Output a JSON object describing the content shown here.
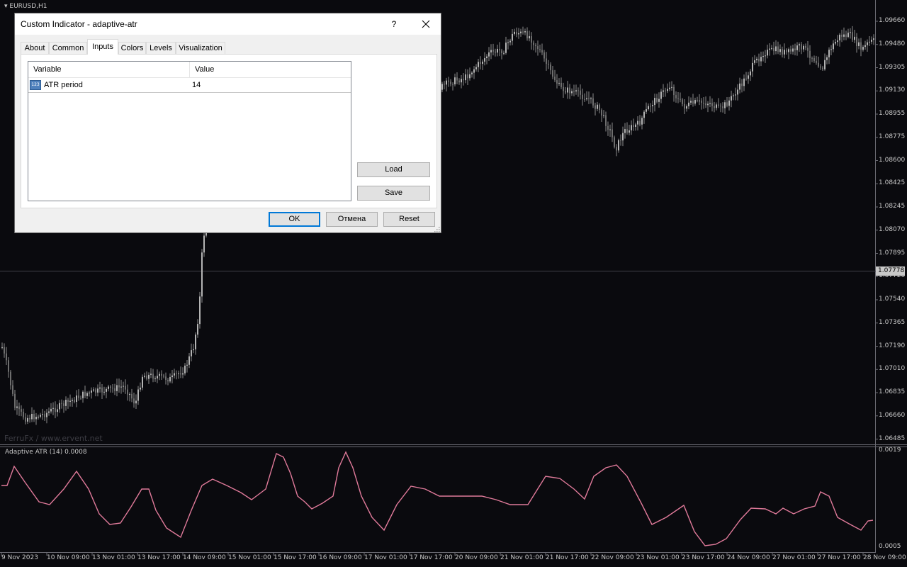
{
  "chart": {
    "symbol": "EURUSD,H1",
    "watermark": "FerruFx / www.ervent.net",
    "current_price": "1.07778",
    "price_axis": [
      "1.09660",
      "1.09480",
      "1.09305",
      "1.09130",
      "1.08955",
      "1.08775",
      "1.08600",
      "1.08425",
      "1.08245",
      "1.08070",
      "1.07895",
      "1.07720",
      "1.07540",
      "1.07365",
      "1.07190",
      "1.07010",
      "1.06835",
      "1.06660",
      "1.06485"
    ],
    "time_axis": [
      "9 Nov 2023",
      "10 Nov 09:00",
      "13 Nov 01:00",
      "13 Nov 17:00",
      "14 Nov 09:00",
      "15 Nov 01:00",
      "15 Nov 17:00",
      "16 Nov 09:00",
      "17 Nov 01:00",
      "17 Nov 17:00",
      "20 Nov 09:00",
      "21 Nov 01:00",
      "21 Nov 17:00",
      "22 Nov 09:00",
      "23 Nov 01:00",
      "23 Nov 17:00",
      "24 Nov 09:00",
      "27 Nov 01:00",
      "27 Nov 17:00",
      "28 Nov 09:00"
    ],
    "indicator_title": "Adaptive ATR (14) 0.0008",
    "indicator_axis": [
      "0.0019",
      "0.0005"
    ],
    "colors": {
      "background": "#0a0a0e",
      "candles": "#8c8c8c",
      "atr_line": "#e07a9a",
      "grid_line": "#404048"
    }
  },
  "dialog": {
    "title": "Custom Indicator - adaptive-atr",
    "help_label": "?",
    "tabs": [
      {
        "label": "About"
      },
      {
        "label": "Common"
      },
      {
        "label": "Inputs"
      },
      {
        "label": "Colors"
      },
      {
        "label": "Levels"
      },
      {
        "label": "Visualization"
      }
    ],
    "active_tab": "Inputs",
    "table": {
      "columns": [
        "Variable",
        "Value"
      ],
      "rows": [
        {
          "type_icon": "123",
          "variable": "ATR period",
          "value": "14"
        }
      ]
    },
    "buttons": {
      "load": "Load",
      "save": "Save",
      "ok": "OK",
      "cancel": "Отмена",
      "reset": "Reset"
    }
  }
}
